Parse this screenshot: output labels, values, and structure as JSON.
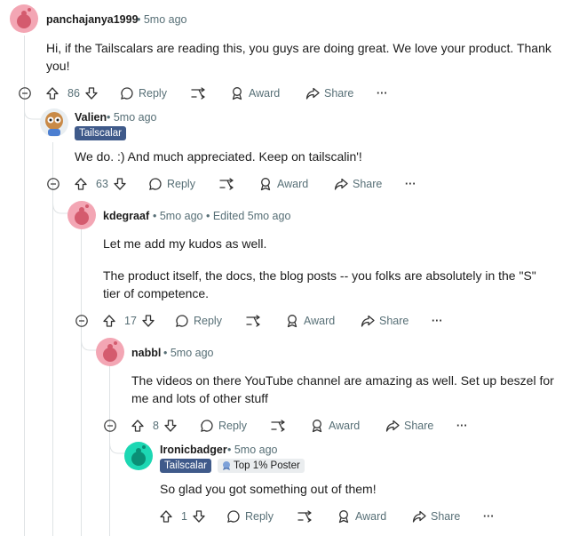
{
  "comments": [
    {
      "username": "panchajanya1999",
      "meta": "5mo ago",
      "body": [
        "Hi, if the Tailscalars are reading this, you guys are doing great. We love your product. Thank",
        "you!"
      ],
      "votes": "86"
    },
    {
      "username": "Valien",
      "meta": "5mo ago",
      "flair": "Tailscalar",
      "body": [
        "We do. :) And much appreciated. Keep on tailscalin'!"
      ],
      "votes": "63"
    },
    {
      "username": "kdegraaf",
      "meta": "5mo ago",
      "edited": "Edited 5mo ago",
      "body": [
        "Let me add my kudos as well.",
        "The product itself, the docs, the blog posts -- you folks are absolutely in the \"S\"",
        "tier of competence."
      ],
      "votes": "17"
    },
    {
      "username": "nabbl",
      "meta": "5mo ago",
      "body": [
        "The videos on there YouTube channel are amazing as well. Set up beszel for",
        "me and lots of other stuff"
      ],
      "votes": "8"
    },
    {
      "username": "Ironicbadger",
      "meta": "5mo ago",
      "flair": "Tailscalar",
      "flair2": "Top 1% Poster",
      "body": [
        "So glad you got something out of them!"
      ],
      "votes": "1"
    }
  ],
  "actions": {
    "reply": "Reply",
    "award": "Award",
    "share": "Share",
    "more": "···"
  },
  "colors": {
    "pink_avatar": "#f3a6b4",
    "teal_avatar": "#1cd7b3",
    "flair_bg": "#3f5a8a",
    "meta": "#576f76"
  }
}
